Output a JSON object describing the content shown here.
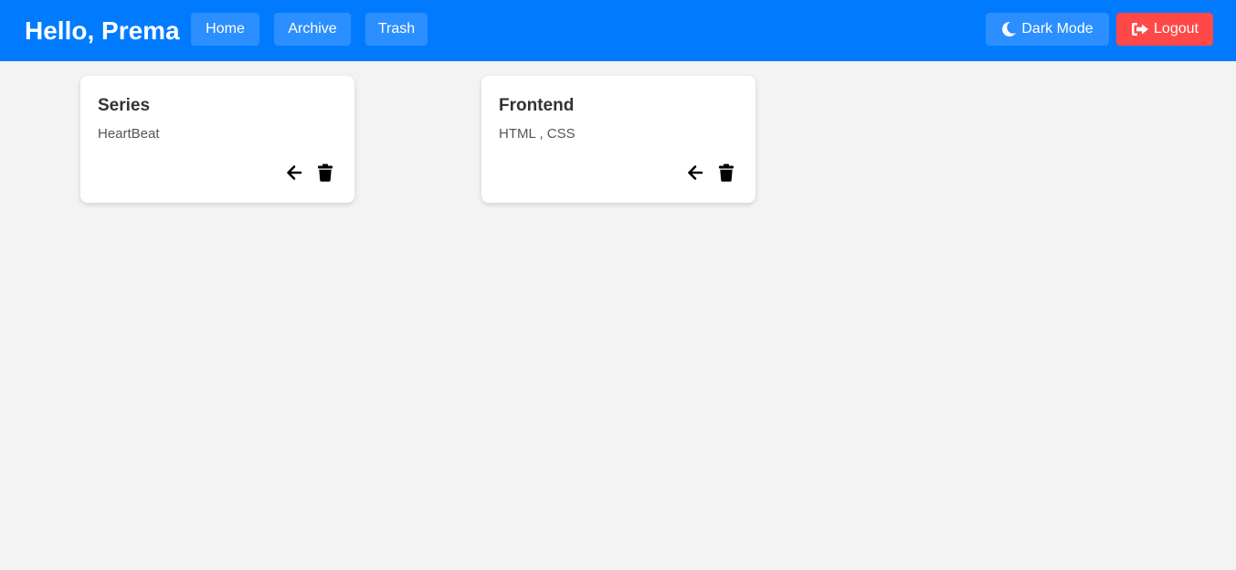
{
  "header": {
    "greeting": "Hello, Prema",
    "nav": [
      {
        "label": "Home"
      },
      {
        "label": "Archive"
      },
      {
        "label": "Trash"
      }
    ],
    "dark_mode_label": "Dark Mode",
    "logout_label": "Logout",
    "dark_mode_icon": "moon-icon",
    "logout_icon": "sign-out-icon"
  },
  "colors": {
    "header_bg": "#007bff",
    "nav_button_bg": "#2b8fff",
    "logout_bg": "#ff4848",
    "page_bg": "#f3f3f3"
  },
  "notes": [
    {
      "title": "Series",
      "content": "HeartBeat",
      "actions": [
        "restore-icon",
        "delete-icon"
      ]
    },
    {
      "title": "Frontend",
      "content": "HTML , CSS",
      "actions": [
        "restore-icon",
        "delete-icon"
      ]
    }
  ]
}
